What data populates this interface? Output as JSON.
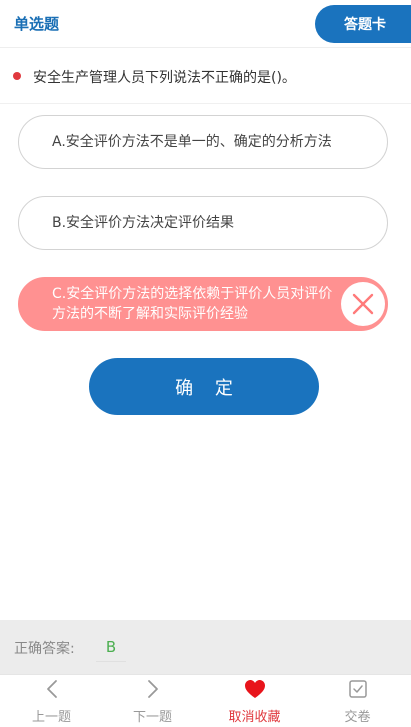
{
  "header": {
    "question_type": "单选题",
    "answer_card_label": "答题卡"
  },
  "question": {
    "text": "安全生产管理人员下列说法不正确的是()。"
  },
  "options": [
    {
      "text": "A.安全评价方法不是单一的、确定的分析方法",
      "state": "normal"
    },
    {
      "text": "B.安全评价方法决定评价结果",
      "state": "normal"
    },
    {
      "text": "C.安全评价方法的选择依赖于评价人员对评价方法的不断了解和实际评价经验",
      "state": "wrong"
    }
  ],
  "confirm_label": "确 定",
  "answer": {
    "label": "正确答案:",
    "value": "B"
  },
  "nav": [
    {
      "label": "上一题",
      "icon": "chevron-left-icon"
    },
    {
      "label": "下一题",
      "icon": "chevron-right-icon"
    },
    {
      "label": "取消收藏",
      "icon": "heart-icon"
    },
    {
      "label": "交卷",
      "icon": "checkbox-icon"
    }
  ],
  "colors": {
    "primary": "#1a73be",
    "wrong": "#ff9191",
    "accent_red": "#e0393e",
    "correct_green": "#4caf50"
  }
}
